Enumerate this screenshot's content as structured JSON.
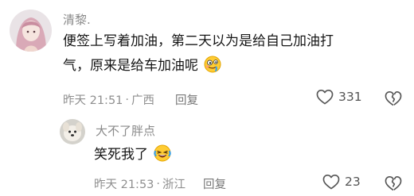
{
  "comments": [
    {
      "username": "清黎.",
      "text_line1": "便签上写着加油，第二天以为是给自己加油打",
      "text_line2": "气，原来是给车加油呢",
      "emoji": "drooling-face-icon",
      "time": "昨天 21:51",
      "separator": "·",
      "location": "广西",
      "reply_label": "回复",
      "likes": "331"
    },
    {
      "username": "大不了胖点",
      "text": "笑死我了",
      "emoji": "crying-laughing-icon",
      "time": "昨天 21:53",
      "separator": "·",
      "location": "浙江",
      "reply_label": "回复",
      "likes": "23"
    }
  ]
}
